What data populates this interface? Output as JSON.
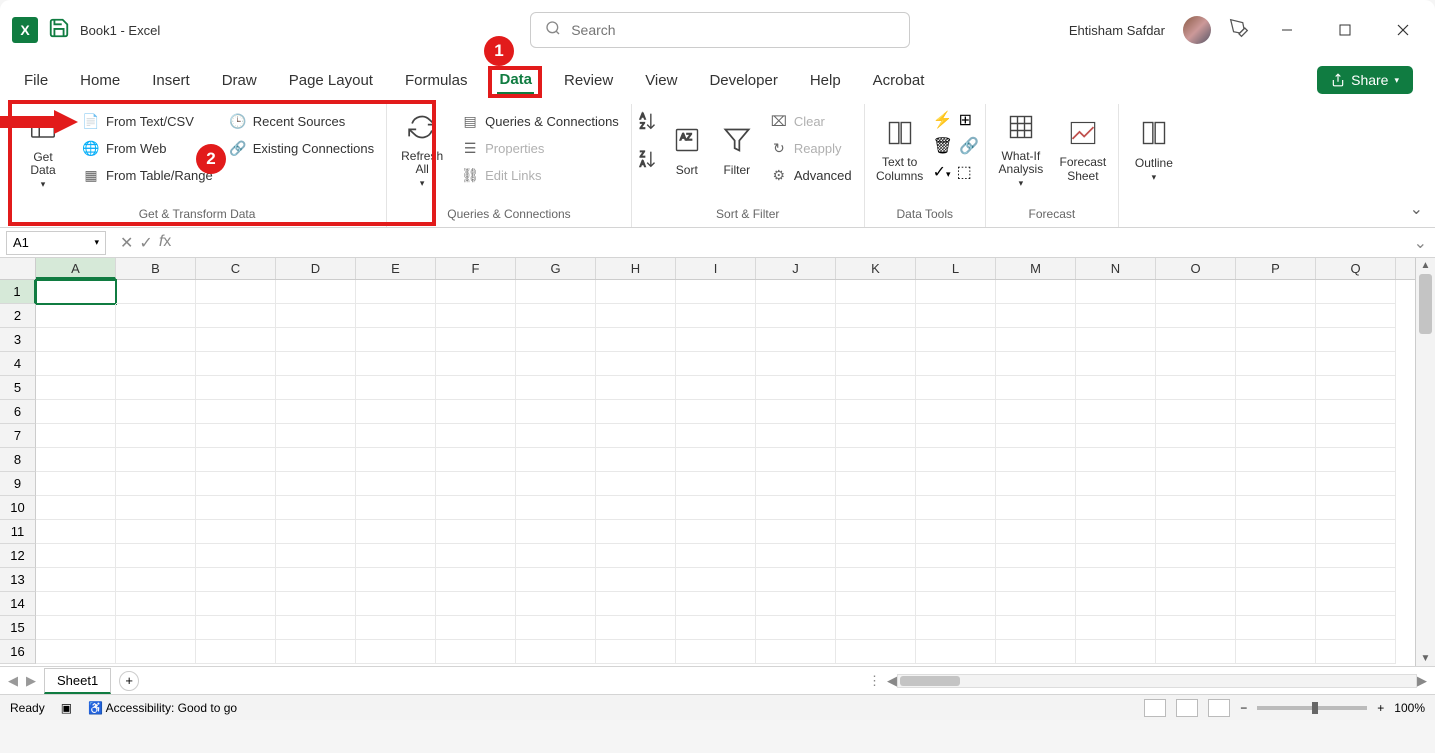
{
  "title": "Book1  -  Excel",
  "search": {
    "placeholder": "Search"
  },
  "user": {
    "name": "Ehtisham Safdar"
  },
  "window": {
    "minimize": "–",
    "maximize": "▢",
    "close": "✕"
  },
  "tabs": {
    "file": "File",
    "home": "Home",
    "insert": "Insert",
    "draw": "Draw",
    "page_layout": "Page Layout",
    "formulas": "Formulas",
    "data": "Data",
    "review": "Review",
    "view": "View",
    "developer": "Developer",
    "help": "Help",
    "acrobat": "Acrobat"
  },
  "share_label": "Share",
  "ribbon": {
    "get_transform": {
      "get_data": "Get\nData",
      "from_text_csv": "From Text/CSV",
      "from_web": "From Web",
      "from_table": "From Table/Range",
      "recent_sources": "Recent Sources",
      "existing_connections": "Existing Connections",
      "label": "Get & Transform Data"
    },
    "queries": {
      "refresh_all": "Refresh\nAll",
      "queries_connections": "Queries & Connections",
      "properties": "Properties",
      "edit_links": "Edit Links",
      "label": "Queries & Connections"
    },
    "sort_filter": {
      "sort": "Sort",
      "filter": "Filter",
      "clear": "Clear",
      "reapply": "Reapply",
      "advanced": "Advanced",
      "label": "Sort & Filter"
    },
    "data_tools": {
      "text_to_columns": "Text to\nColumns",
      "label": "Data Tools"
    },
    "forecast": {
      "what_if": "What-If\nAnalysis",
      "forecast_sheet": "Forecast\nSheet",
      "label": "Forecast"
    },
    "outline": {
      "outline": "Outline",
      "label": ""
    }
  },
  "annotations": {
    "one": "1",
    "two": "2"
  },
  "namebox": "A1",
  "columns": [
    "A",
    "B",
    "C",
    "D",
    "E",
    "F",
    "G",
    "H",
    "I",
    "J",
    "K",
    "L",
    "M",
    "N",
    "O",
    "P",
    "Q"
  ],
  "rows": [
    "1",
    "2",
    "3",
    "4",
    "5",
    "6",
    "7",
    "8",
    "9",
    "10",
    "11",
    "12",
    "13",
    "14",
    "15",
    "16"
  ],
  "active_cell": {
    "row": 0,
    "col": 0
  },
  "sheet": {
    "name": "Sheet1"
  },
  "status": {
    "ready": "Ready",
    "accessibility": "Accessibility: Good to go",
    "zoom": "100%"
  }
}
